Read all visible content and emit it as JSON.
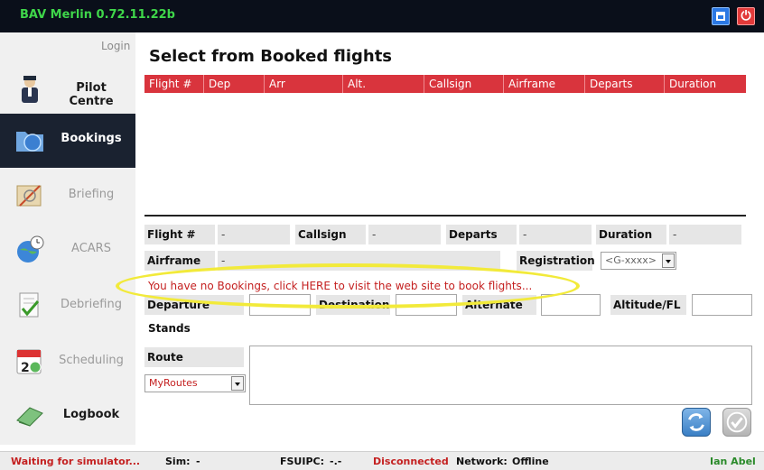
{
  "window": {
    "title": "BAV Merlin 0.72.11.22b",
    "minimize_icon": "window-minimize-icon",
    "close_icon": "power-close-icon",
    "close_glyph": "⏻"
  },
  "sidebar": {
    "login": "Login",
    "items": [
      {
        "label": "Pilot Centre",
        "icon": "pilot-icon",
        "state": "enabled"
      },
      {
        "label": "Bookings",
        "icon": "folder-globe-icon",
        "state": "active"
      },
      {
        "label": "Briefing",
        "icon": "compass-map-icon",
        "state": "disabled"
      },
      {
        "label": "ACARS",
        "icon": "globe-clock-icon",
        "state": "disabled"
      },
      {
        "label": "Debriefing",
        "icon": "checklist-icon",
        "state": "disabled"
      },
      {
        "label": "Scheduling",
        "icon": "calendar-icon",
        "state": "disabled"
      },
      {
        "label": "Logbook",
        "icon": "logbook-icon",
        "state": "enabled"
      }
    ]
  },
  "main": {
    "heading": "Select from Booked flights",
    "columns": [
      "Flight #",
      "Dep",
      "Arr",
      "Alt.",
      "Callsign",
      "Airframe",
      "Departs",
      "Duration"
    ],
    "rows": []
  },
  "details": {
    "flight_label": "Flight #",
    "flight_value": "-",
    "callsign_label": "Callsign",
    "callsign_value": "-",
    "departs_label": "Departs",
    "departs_value": "-",
    "duration_label": "Duration",
    "duration_value": "-",
    "airframe_label": "Airframe",
    "airframe_value": "-",
    "registration_label": "Registration",
    "registration_value": "<G-xxxx>",
    "no_bookings": "You have no Bookings, click HERE to visit the web site to book flights...",
    "departure_label": "Departure",
    "destination_label": "Destination",
    "alternate_label": "Alternate",
    "altitude_label": "Altitude/FL",
    "stands_label": "Stands",
    "route_label": "Route",
    "route_select": "MyRoutes"
  },
  "actions": {
    "refresh_icon": "refresh-icon",
    "confirm_icon": "checkmark-icon"
  },
  "status": {
    "waiting": "Waiting for simulator...",
    "sim_label": "Sim:",
    "sim_value": "-",
    "fsuipc_label": "FSUIPC:",
    "fsuipc_value": "-.-",
    "connection": "Disconnected",
    "network_label": "Network:",
    "network_value": "Offline",
    "user": "Ian Abel"
  },
  "colors": {
    "accent_red": "#d9343d",
    "title_green": "#3fd64a",
    "highlight_yellow": "#f2ea3a",
    "status_green": "#2a8a2a"
  }
}
